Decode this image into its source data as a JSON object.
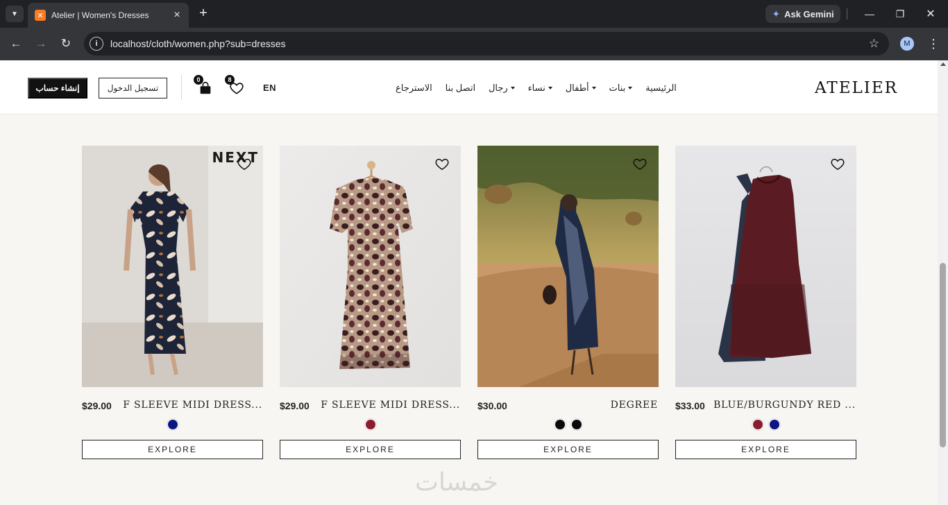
{
  "browser": {
    "tab_title": "Atelier | Women's Dresses",
    "url": "localhost/cloth/women.php?sub=dresses",
    "gemini_label": "Ask Gemini",
    "profile_initial": "M"
  },
  "header": {
    "brand": "ATELIER",
    "nav": [
      {
        "label": "الرئيسية",
        "dropdown": false
      },
      {
        "label": "بنات",
        "dropdown": true
      },
      {
        "label": "أطفال",
        "dropdown": true
      },
      {
        "label": "نساء",
        "dropdown": true
      },
      {
        "label": "رجال",
        "dropdown": true
      },
      {
        "label": "اتصل بنا",
        "dropdown": false
      },
      {
        "label": "الاسترجاع",
        "dropdown": false
      }
    ],
    "language": "EN",
    "wishlist_count": "8",
    "cart_count": "0",
    "login_label": "تسجيل الدخول",
    "signup_label": "إنشاء حساب"
  },
  "products": [
    {
      "name": "BLUE/BURGUNDY RED ...",
      "price": "$33.00",
      "colors": [
        "#8b1c2b",
        "#0d1680"
      ],
      "image": "two-sleeveless-dresses"
    },
    {
      "name": "DEGREE",
      "price": "$30.00",
      "colors": [
        "#0a0a0a",
        "#0a0a0a"
      ],
      "image": "floral-maternity-dress-outdoor"
    },
    {
      "name": "F SLEEVE MIDI DRESS...",
      "price": "$29.00",
      "colors": [
        "#8b1c2b"
      ],
      "image": "leopard-print-dress-hanger"
    },
    {
      "name": "F SLEEVE MIDI DRESS...",
      "price": "$29.00",
      "colors": [
        "#0d1680"
      ],
      "image": "floral-navy-dress-model",
      "badge": "NEXT"
    }
  ],
  "explore_label": "EXPLORE",
  "watermark": "خمسات",
  "theme": {
    "accent": "#111111",
    "page_bg": "#f7f6f3",
    "chrome_dark": "#202124"
  }
}
